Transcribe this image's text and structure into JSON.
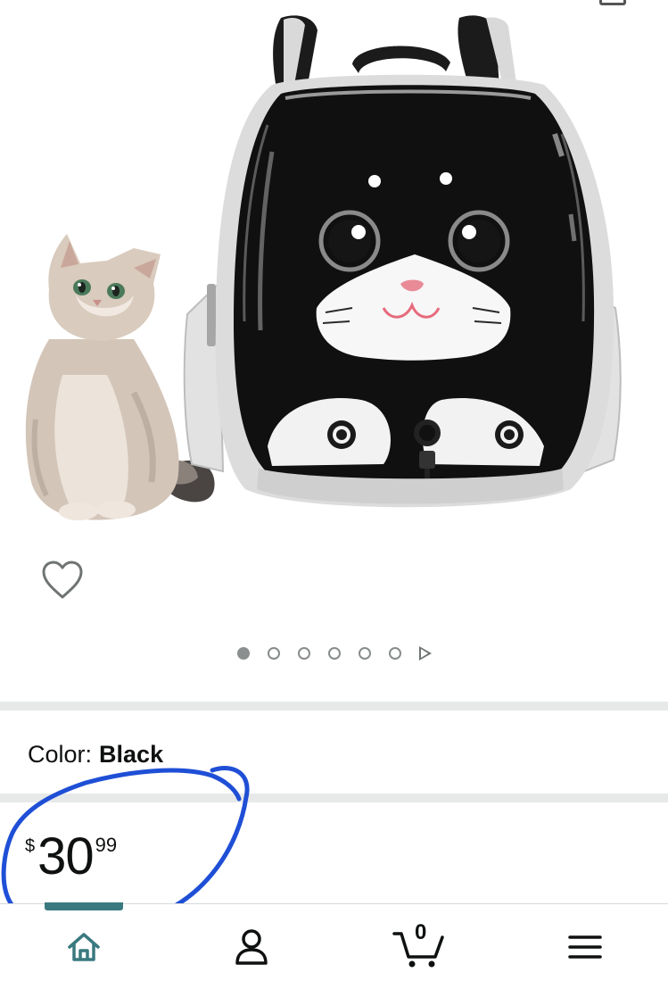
{
  "product": {
    "variation_label": "Color:",
    "variation_value": "Black"
  },
  "gallery": {
    "image_count": 6,
    "active_index": 0,
    "icons": [
      "share-icon",
      "heart-icon",
      "play-icon"
    ]
  },
  "price": {
    "symbol": "$",
    "whole": "30",
    "fraction": "99"
  },
  "bottom_nav": {
    "items": [
      {
        "name": "home",
        "icon": "home-icon",
        "active": true
      },
      {
        "name": "account",
        "icon": "account-icon",
        "active": false
      },
      {
        "name": "cart",
        "icon": "cart-icon",
        "active": false
      },
      {
        "name": "menu",
        "icon": "menu-icon",
        "active": false
      }
    ],
    "cart_count": "0"
  },
  "colors": {
    "accent": "#39797f",
    "annotation": "#1f4fd6",
    "text": "#0f1111",
    "separator": "#e7e9e9"
  }
}
